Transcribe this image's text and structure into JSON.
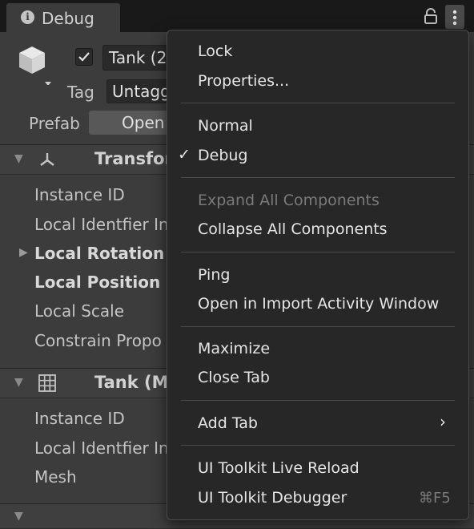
{
  "tab": {
    "title": "Debug",
    "info_icon": "info-icon",
    "lock_icon": "lock-icon",
    "menu_icon": "kebab-menu-icon"
  },
  "inspector": {
    "object_name": "Tank (2",
    "tag_label": "Tag",
    "tag_value": "Untagg",
    "prefab_label": "Prefab",
    "prefab_open_button": "Open",
    "enabled_checked": true,
    "transform": {
      "title": "Transfor",
      "rows": [
        {
          "label": "Instance ID",
          "bold": false
        },
        {
          "label": "Local Identfier In",
          "bold": false
        },
        {
          "label": "Local Rotation",
          "bold": true,
          "expandable": true
        },
        {
          "label": "Local Position",
          "bold": true
        },
        {
          "label": "Local Scale",
          "bold": false
        },
        {
          "label": "Constrain Propo",
          "bold": false
        }
      ]
    },
    "mesh_filter": {
      "title": "Tank (Me",
      "rows": [
        {
          "label": "Instance ID"
        },
        {
          "label": "Local Identfier In"
        },
        {
          "label": "Mesh"
        }
      ]
    }
  },
  "menu": {
    "lock": "Lock",
    "properties": "Properties...",
    "normal": "Normal",
    "debug": "Debug",
    "debug_checkmark": "✓",
    "expand_all": "Expand All Components",
    "collapse_all": "Collapse All Components",
    "ping": "Ping",
    "open_import_activity": "Open in Import Activity Window",
    "maximize": "Maximize",
    "close_tab": "Close Tab",
    "add_tab": "Add Tab",
    "add_tab_arrow": "›",
    "live_reload": "UI Toolkit Live Reload",
    "debugger": "UI Toolkit Debugger",
    "debugger_shortcut": "⌘F5"
  }
}
